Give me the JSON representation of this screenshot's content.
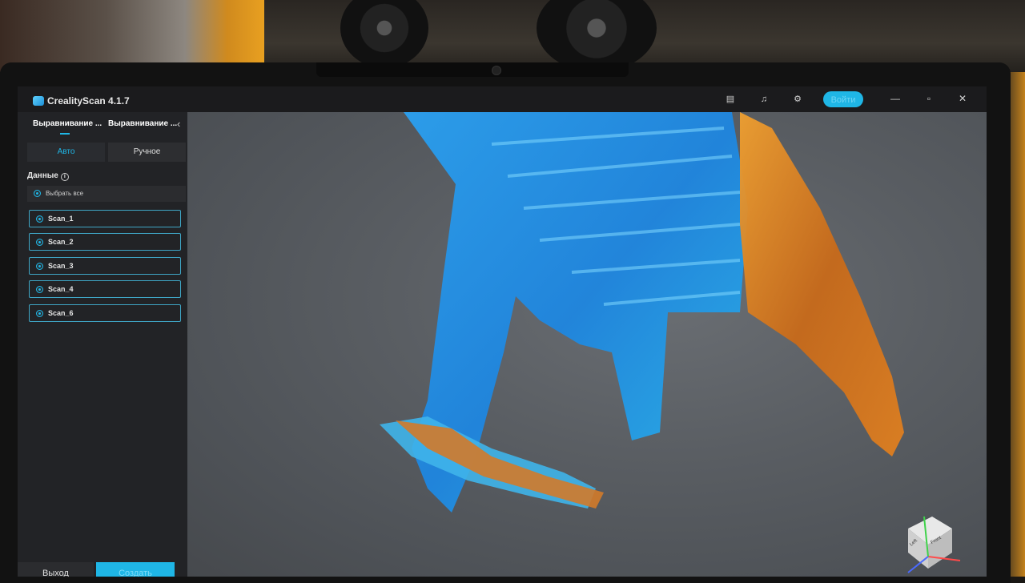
{
  "app": {
    "title": "CrealityScan 4.1.7"
  },
  "titlebar": {
    "login_label": "Войти"
  },
  "sidebar": {
    "tabs": [
      "Выравнивание ...",
      "Выравнивание ..."
    ],
    "modes": {
      "auto": "Авто",
      "manual": "Ручное"
    },
    "data_label": "Данные",
    "select_all": "Выбрать все",
    "scans": [
      "Scan_1",
      "Scan_2",
      "Scan_3",
      "Scan_4",
      "Scan_6"
    ],
    "exit_label": "Выход",
    "create_plane_label": "Создать плоскость"
  },
  "viewport": {
    "gizmo_labels": {
      "left": "Left",
      "front": "Front"
    }
  },
  "colors": {
    "accent": "#1fb6e6",
    "mesh_blue": "#1e8fe0",
    "mesh_orange": "#e08a1e"
  }
}
